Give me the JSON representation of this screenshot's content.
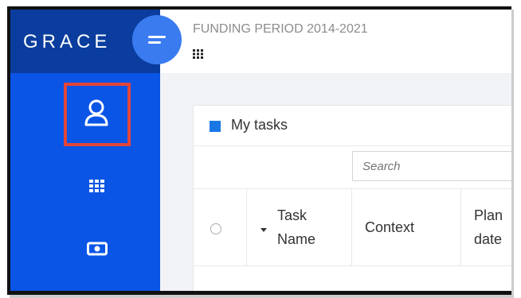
{
  "app": {
    "logo": "GRACE"
  },
  "header": {
    "funding_period": "FUNDING PERIOD 2014-2021"
  },
  "tasks": {
    "title": "My tasks",
    "search_placeholder": "Search",
    "columns": {
      "task_name_line1": "Task",
      "task_name_line2": "Name",
      "context": "Context",
      "planned_line1": "Plan",
      "planned_line2": "date"
    }
  },
  "icons": [
    "hamburger-icon",
    "user-icon",
    "apps-grid-icon",
    "money-icon"
  ],
  "colors": {
    "sidebar": "#0a55e6",
    "logo_bar": "#0a3d9e",
    "highlight": "#e4453a"
  }
}
